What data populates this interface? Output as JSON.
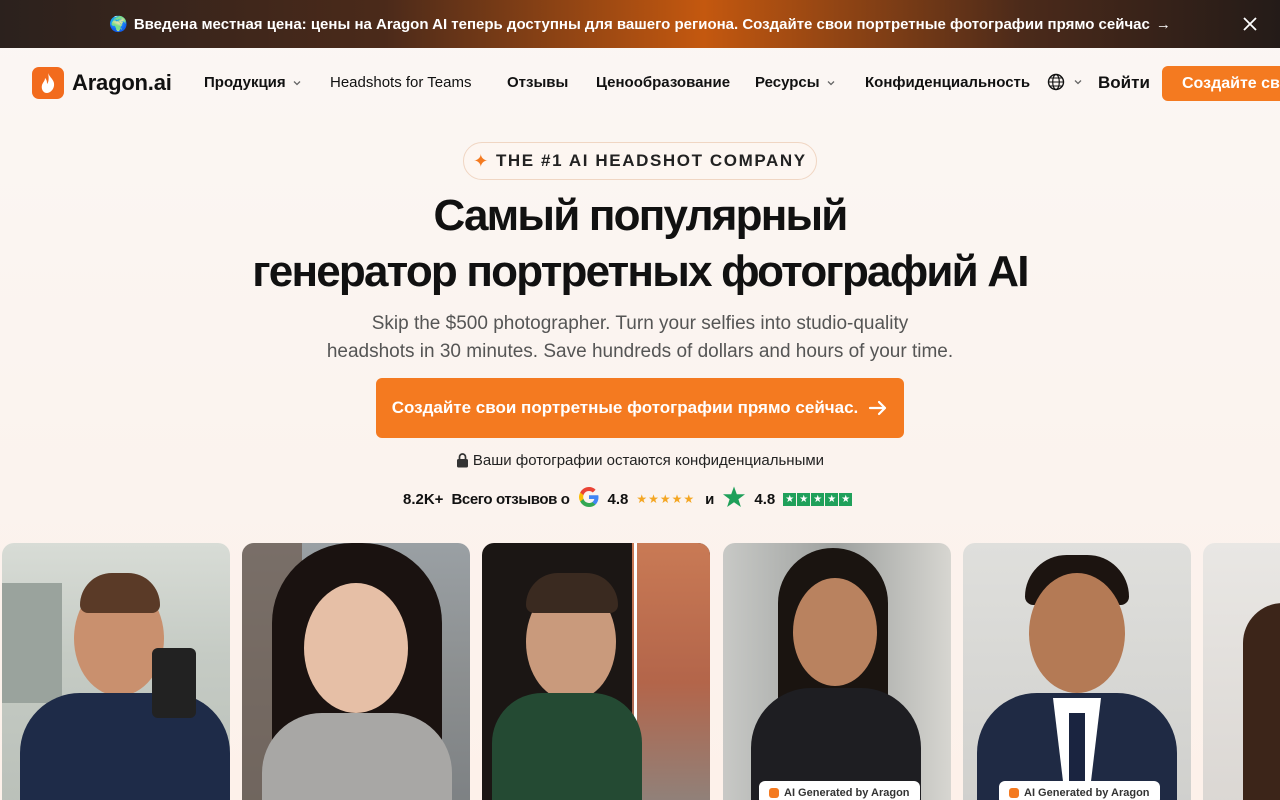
{
  "banner": {
    "text": "Введена местная цена: цены на Aragon AI теперь доступны для вашего региона. Создайте свои портретные фотографии прямо сейчас",
    "globe_emoji": "🌍",
    "arrow": "→"
  },
  "nav": {
    "logo_text": "Aragon.ai",
    "items": [
      {
        "label": "Продукция"
      },
      {
        "label": "Headshots for Teams"
      },
      {
        "label": "Отзывы"
      },
      {
        "label": "Ценообразование"
      },
      {
        "label": "Ресурсы"
      },
      {
        "label": "Конфиденциальность"
      }
    ],
    "login": "Войти",
    "cta": "Создайте свои"
  },
  "hero": {
    "pill": "THE #1 AI HEADSHOT COMPANY",
    "title_line1": "Самый популярный",
    "title_line2": "генератор портретных фотографий AI",
    "subtitle_line1": "Skip the $500 photographer. Turn your selfies into studio-quality",
    "subtitle_line2": "headshots in 30 minutes. Save hundreds of dollars and hours of your time.",
    "cta": "Создайте свои портретные фотографии прямо сейчас.",
    "privacy": "Ваши фотографии остаются конфиденциальными"
  },
  "reviews": {
    "count": "8.2K+",
    "label": "Всего отзывов о",
    "google_rating": "4.8",
    "google_stars": "★★★★★",
    "and": "и",
    "trustpilot_rating": "4.8"
  },
  "photos": {
    "badge": "AI Generated by Aragon"
  },
  "colors": {
    "accent": "#f47a20",
    "trustpilot": "#1fa05a"
  }
}
